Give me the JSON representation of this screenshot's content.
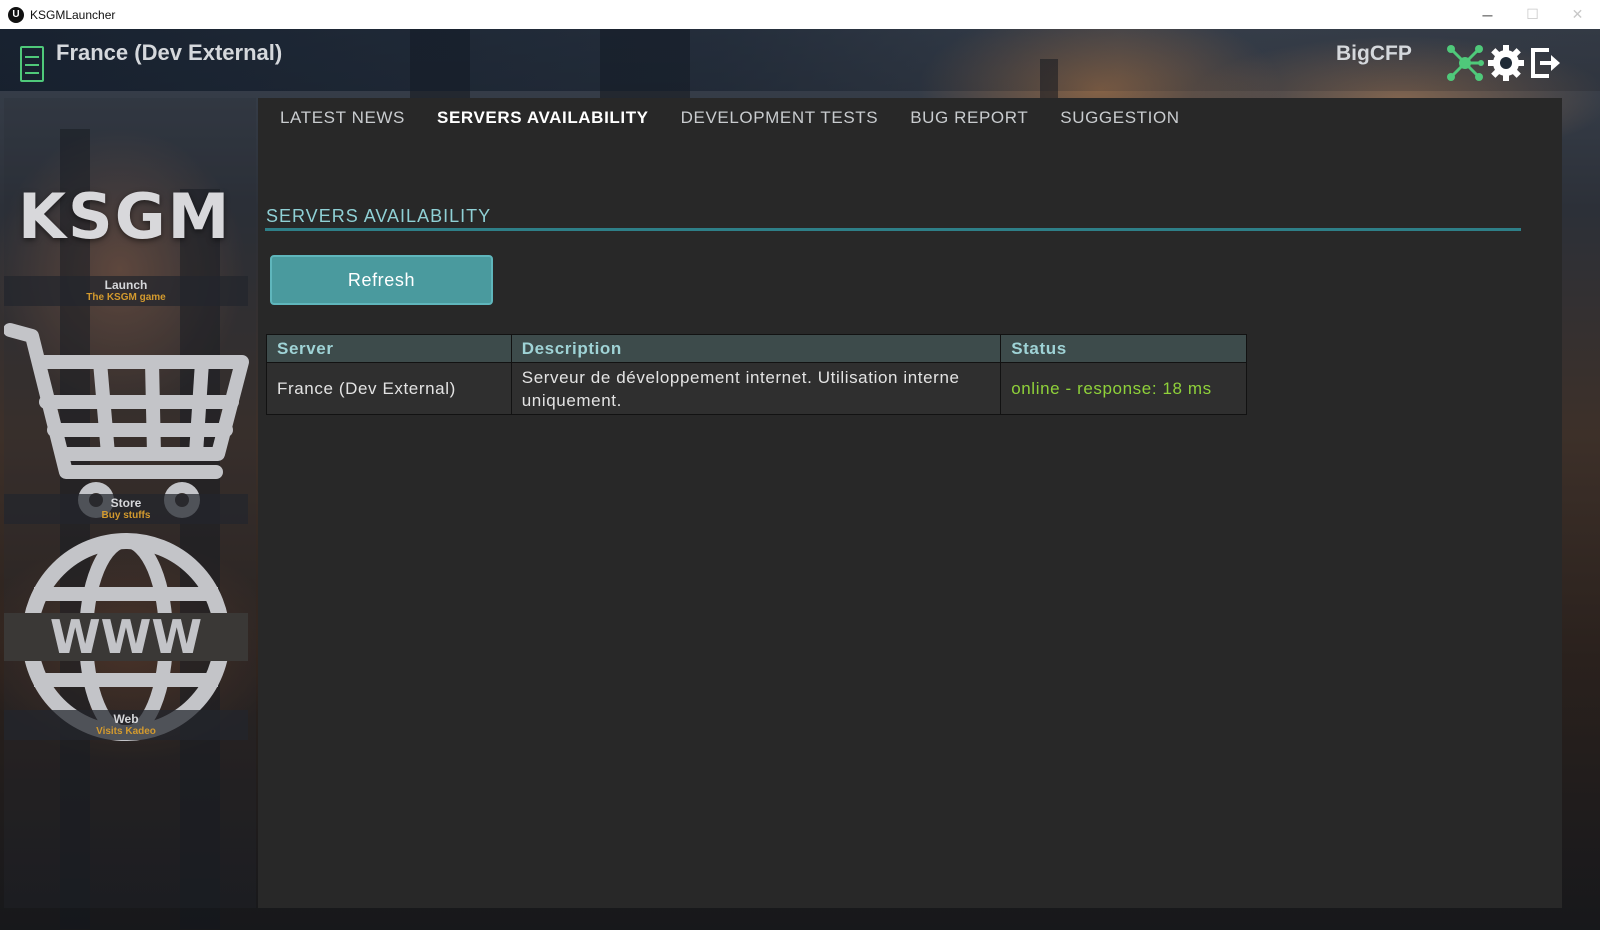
{
  "window": {
    "app_icon": "unreal-engine-icon",
    "title": "KSGMLauncher",
    "minimize": "─",
    "maximize": "☐",
    "close": "✕"
  },
  "header": {
    "server_icon": "server-rack-icon",
    "server_name": "France (Dev External)",
    "username": "BigCFP",
    "icons": [
      "network-icon",
      "gear-icon",
      "logout-icon"
    ],
    "accent_color": "#4fc97a"
  },
  "sidebar": {
    "logo_text": "KSGM",
    "tiles": [
      {
        "title": "Launch",
        "subtitle": "The KSGM game",
        "icon": "logo-icon"
      },
      {
        "title": "Store",
        "subtitle": "Buy stuffs",
        "icon": "shopping-cart-icon"
      },
      {
        "title": "Web",
        "subtitle": "Visits Kadeo",
        "icon": "globe-www-icon"
      }
    ],
    "subtitle_color": "#d39a2e"
  },
  "tabs": [
    {
      "label": "LATEST NEWS",
      "active": false
    },
    {
      "label": "SERVERS AVAILABILITY",
      "active": true
    },
    {
      "label": "DEVELOPMENT TESTS",
      "active": false
    },
    {
      "label": "BUG REPORT",
      "active": false
    },
    {
      "label": "SUGGESTION",
      "active": false
    }
  ],
  "content": {
    "section_title": "SERVERS AVAILABILITY",
    "refresh_label": "Refresh",
    "table": {
      "columns": [
        "Server",
        "Description",
        "Status"
      ],
      "rows": [
        {
          "server": "France (Dev External)",
          "description": "Serveur de développement internet. Utilisation interne uniquement.",
          "status": "online - response: 18 ms",
          "status_color": "#8fd13a"
        }
      ]
    }
  }
}
